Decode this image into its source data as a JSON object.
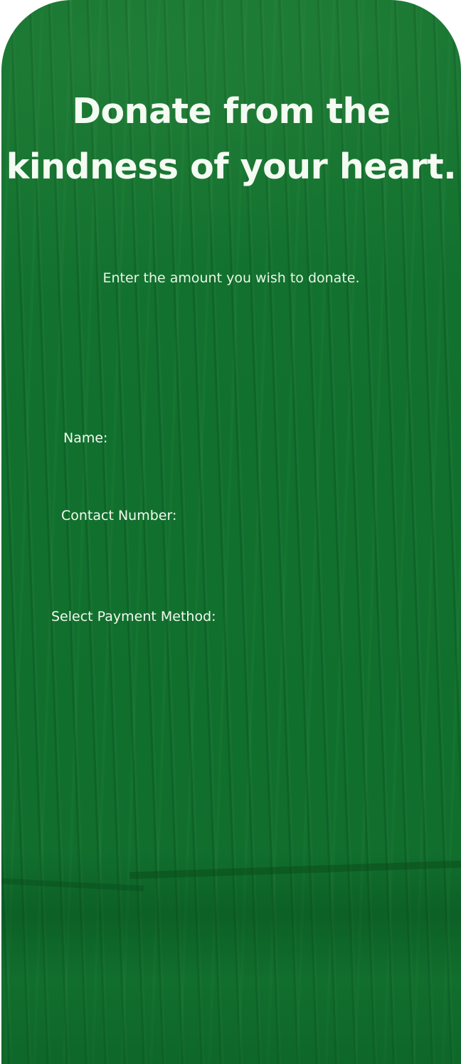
{
  "hero": {
    "headline": "Donate from the kindness of your heart.",
    "subtitle": "Enter the amount you wish to donate."
  },
  "form": {
    "name_label": "Name:",
    "contact_label": "Contact Number:",
    "payment_label": "Select Payment Method:"
  },
  "colors": {
    "panel_background": "#12712f",
    "text": "#ffffff"
  }
}
